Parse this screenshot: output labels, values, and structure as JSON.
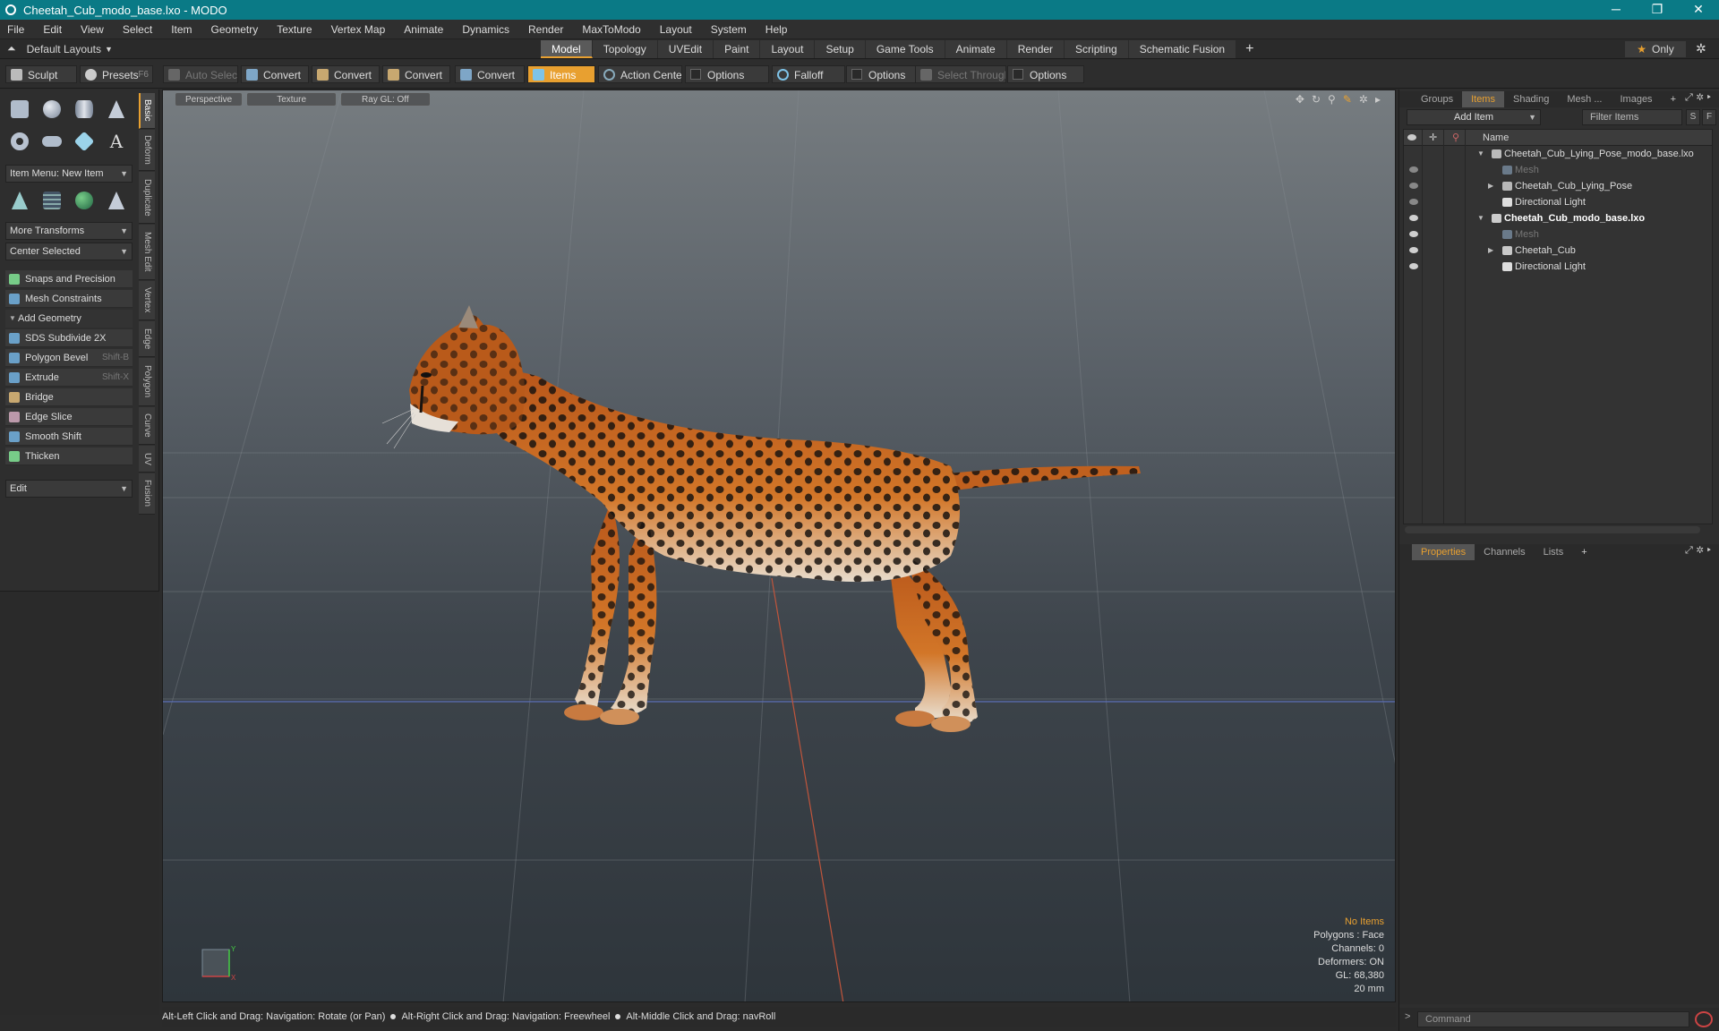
{
  "window": {
    "title": "Cheetah_Cub_modo_base.lxo - MODO",
    "minimize": "─",
    "maximize": "❐",
    "close": "✕"
  },
  "menu": [
    "File",
    "Edit",
    "View",
    "Select",
    "Item",
    "Geometry",
    "Texture",
    "Vertex Map",
    "Animate",
    "Dynamics",
    "Render",
    "MaxToModo",
    "Layout",
    "System",
    "Help"
  ],
  "layout_bar": {
    "dropdown": "Default Layouts",
    "tabs": [
      "Model",
      "Topology",
      "UVEdit",
      "Paint",
      "Layout",
      "Setup",
      "Game Tools",
      "Animate",
      "Render",
      "Scripting",
      "Schematic Fusion"
    ],
    "active_tab": "Model",
    "plus": "+",
    "only_label": "Only"
  },
  "toolbar": {
    "sculpt": "Sculpt",
    "presets": "Presets",
    "presets_key": "F6",
    "auto_select": "Auto Select",
    "convert1": "Convert",
    "convert2": "Convert",
    "convert3": "Convert",
    "convert4": "Convert",
    "items": "Items",
    "action_center": "Action Center",
    "options1": "Options",
    "falloff": "Falloff",
    "options2": "Options",
    "select_through": "Select Through",
    "options3": "Options"
  },
  "left_panel": {
    "item_menu": "Item Menu: New Item",
    "more_transforms": "More Transforms",
    "center_selected": "Center Selected",
    "snaps": "Snaps and Precision",
    "mesh_constraints": "Mesh Constraints",
    "add_geometry": "Add Geometry",
    "tools": [
      {
        "label": "SDS Subdivide 2X",
        "shortcut": ""
      },
      {
        "label": "Polygon Bevel",
        "shortcut": "Shift-B"
      },
      {
        "label": "Extrude",
        "shortcut": "Shift-X"
      },
      {
        "label": "Bridge",
        "shortcut": ""
      },
      {
        "label": "Edge Slice",
        "shortcut": ""
      },
      {
        "label": "Smooth Shift",
        "shortcut": ""
      },
      {
        "label": "Thicken",
        "shortcut": ""
      }
    ],
    "edit_dropdown": "Edit",
    "vertical_tabs": [
      "Basic",
      "Deform",
      "Duplicate",
      "Mesh Edit",
      "Vertex",
      "Edge",
      "Polygon",
      "Curve",
      "UV",
      "Fusion"
    ]
  },
  "viewport": {
    "perspective": "Perspective",
    "texture": "Texture",
    "raygl": "Ray GL: Off",
    "info": {
      "no_items": "No Items",
      "polygons": "Polygons : Face",
      "channels": "Channels: 0",
      "deformers": "Deformers: ON",
      "gl": "GL: 68,380",
      "scale": "20 mm"
    },
    "axis_y": "Y",
    "axis_x": "X"
  },
  "statusbar": {
    "hint1": "Alt-Left Click and Drag: Navigation: Rotate (or Pan)",
    "hint2": "Alt-Right Click and Drag: Navigation: Freewheel",
    "hint3": "Alt-Middle Click and Drag: navRoll"
  },
  "right_panel": {
    "tabs": [
      "Groups",
      "Items",
      "Shading",
      "Mesh ...",
      "Images"
    ],
    "active_tab": "Items",
    "add_item": "Add Item",
    "filter_items": "Filter Items",
    "s_btn": "S",
    "f_btn": "F",
    "name_col": "Name",
    "tree": [
      {
        "label": "Cheetah_Cub_Lying_Pose_modo_base.lxo",
        "bold": false,
        "dim": false
      },
      {
        "label": "Mesh",
        "bold": false,
        "dim": true
      },
      {
        "label": "Cheetah_Cub_Lying_Pose",
        "bold": false,
        "dim": false
      },
      {
        "label": "Directional Light",
        "bold": false,
        "dim": false
      },
      {
        "label": "Cheetah_Cub_modo_base.lxo",
        "bold": true,
        "dim": false
      },
      {
        "label": "Mesh",
        "bold": false,
        "dim": true
      },
      {
        "label": "Cheetah_Cub",
        "bold": false,
        "dim": false
      },
      {
        "label": "Directional Light",
        "bold": false,
        "dim": false
      }
    ],
    "bottom_tabs": [
      "Properties",
      "Channels",
      "Lists"
    ],
    "bottom_active": "Properties",
    "plus": "+",
    "command_placeholder": "Command"
  },
  "colors": {
    "titlebar": "#0a7a86",
    "accent": "#e8a030",
    "fur": "#c4621c",
    "spot": "#1a1410"
  }
}
